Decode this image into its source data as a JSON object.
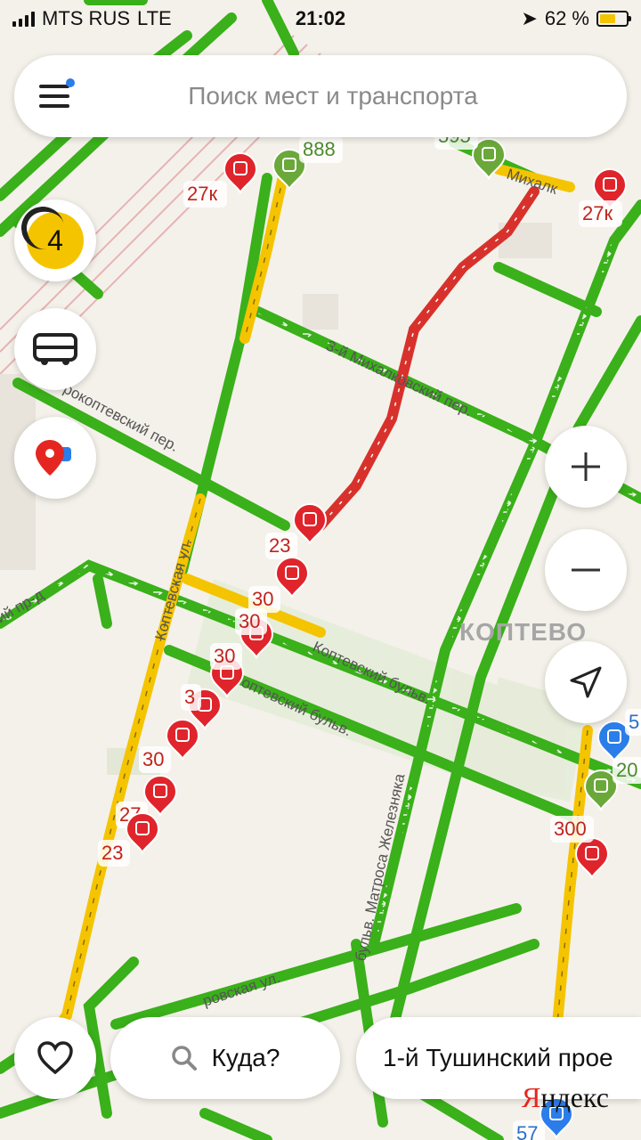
{
  "status_bar": {
    "carrier": "MTS RUS",
    "network": "LTE",
    "time": "21:02",
    "battery": "62 %",
    "battery_level": 0.62
  },
  "search": {
    "placeholder": "Поиск мест и транспорта"
  },
  "traffic": {
    "level": "4"
  },
  "bottom": {
    "where_label": "Куда?",
    "suggestion": "1-й Тушинский прое"
  },
  "brand": {
    "first": "Я",
    "rest": "ндекс"
  },
  "district": "КОПТЕВО",
  "streets": [
    "Коптевская ул.",
    "3-й Михалковский пер.",
    "Коптевский бульв.",
    "рокоптевский пер.",
    "Коптевский бульв.",
    "бульв. Матроса Железняка",
    "ровская ул.",
    "Михалк",
    "ий пр-д"
  ],
  "route_numbers": [
    "888",
    "27к",
    "27к",
    "595",
    "23",
    "30",
    "30",
    "30",
    "3",
    "30",
    "27",
    "23",
    "5",
    "20",
    "300",
    "57"
  ],
  "colors": {
    "accent": "#2b7de9",
    "traffic_green": "#3ab01a",
    "traffic_yellow": "#f5c400",
    "traffic_red": "#d8312c",
    "bus_green": "#6aa83a",
    "tram_red": "#e0242b"
  },
  "icons": [
    "signal-icon",
    "location-arrow-icon",
    "battery-icon",
    "menu-icon",
    "bus-icon",
    "pin-icon",
    "plus-icon",
    "minus-icon",
    "navigate-icon",
    "heart-icon",
    "search-icon",
    "tram-icon"
  ]
}
